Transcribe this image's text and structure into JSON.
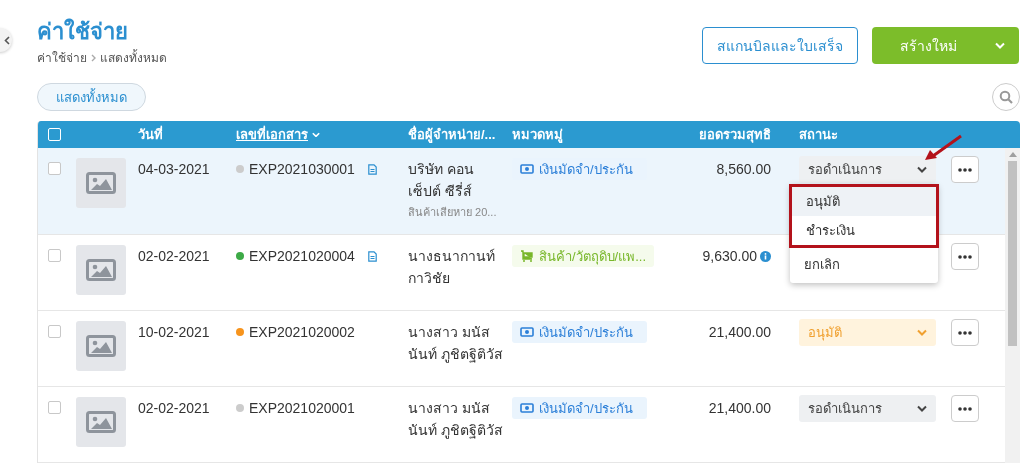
{
  "header": {
    "title": "ค่าใช้จ่าย",
    "breadcrumb": [
      "ค่าใช้จ่าย",
      "แสดงทั้งหมด"
    ]
  },
  "actions": {
    "scan_button": "สแกนบิลและใบเสร็จ",
    "create_button": "สร้างใหม่"
  },
  "filter": {
    "label": "แสดงทั้งหมด"
  },
  "table": {
    "select_all_checked": false,
    "columns": [
      {
        "label": "วันที่",
        "sortable": false
      },
      {
        "label": "เลขที่เอกสาร",
        "sortable": true
      },
      {
        "label": "ชื่อผู้จำหน่าย/...",
        "sortable": false
      },
      {
        "label": "หมวดหมู่",
        "sortable": false
      },
      {
        "label": "ยอดรวมสุทธิ",
        "sortable": false
      },
      {
        "label": "สถานะ",
        "sortable": false
      }
    ],
    "rows": [
      {
        "checked": false,
        "highlighted": true,
        "date": "04-03-2021",
        "color": "#cccccc",
        "doc_no": "EXP2021030001",
        "attachment": true,
        "vendor": "บริษัท คอน เซ็ปต์ ซีรี่ส์",
        "note": "สินค้าเสียหาย 20...",
        "category": {
          "kind": "deposit",
          "label": "เงินมัดจำ/ประกัน"
        },
        "amount": "8,560.00",
        "info": false,
        "status": {
          "kind": "pending",
          "label": "รอดำเนินการ"
        },
        "status_menu": [
          {
            "label": "อนุมัติ",
            "highlighted": true,
            "annotated": true
          },
          {
            "label": "ชำระเงิน",
            "highlighted": false,
            "annotated": true
          },
          {
            "label": "ยกเลิก",
            "highlighted": false,
            "annotated": false
          }
        ]
      },
      {
        "checked": false,
        "highlighted": false,
        "date": "02-02-2021",
        "color": "#3daa47",
        "doc_no": "EXP2021020004",
        "attachment": true,
        "vendor": "นางธนากานท์ กาวิชัย",
        "category": {
          "kind": "goods",
          "label": "สินค้า/วัตถุดิบ/แพ..."
        },
        "amount": "9,630.00",
        "info": true
      },
      {
        "checked": false,
        "highlighted": false,
        "date": "10-02-2021",
        "color": "#f7941d",
        "doc_no": "EXP2021020002",
        "attachment": false,
        "vendor": "นางสาว มนัส นันท์ ภูชิตฐิติวัส",
        "category": {
          "kind": "deposit",
          "label": "เงินมัดจำ/ประกัน"
        },
        "amount": "21,400.00",
        "info": false,
        "status": {
          "kind": "approved",
          "label": "อนุมัติ"
        }
      },
      {
        "checked": false,
        "highlighted": false,
        "date": "02-02-2021",
        "color": "#cccccc",
        "doc_no": "EXP2021020001",
        "attachment": false,
        "vendor": "นางสาว มนัส นันท์ ภูชิตฐิติวัส",
        "category": {
          "kind": "deposit",
          "label": "เงินมัดจำ/ประกัน"
        },
        "amount": "21,400.00",
        "info": false,
        "status": {
          "kind": "pending",
          "label": "รอดำเนินการ"
        }
      }
    ]
  }
}
